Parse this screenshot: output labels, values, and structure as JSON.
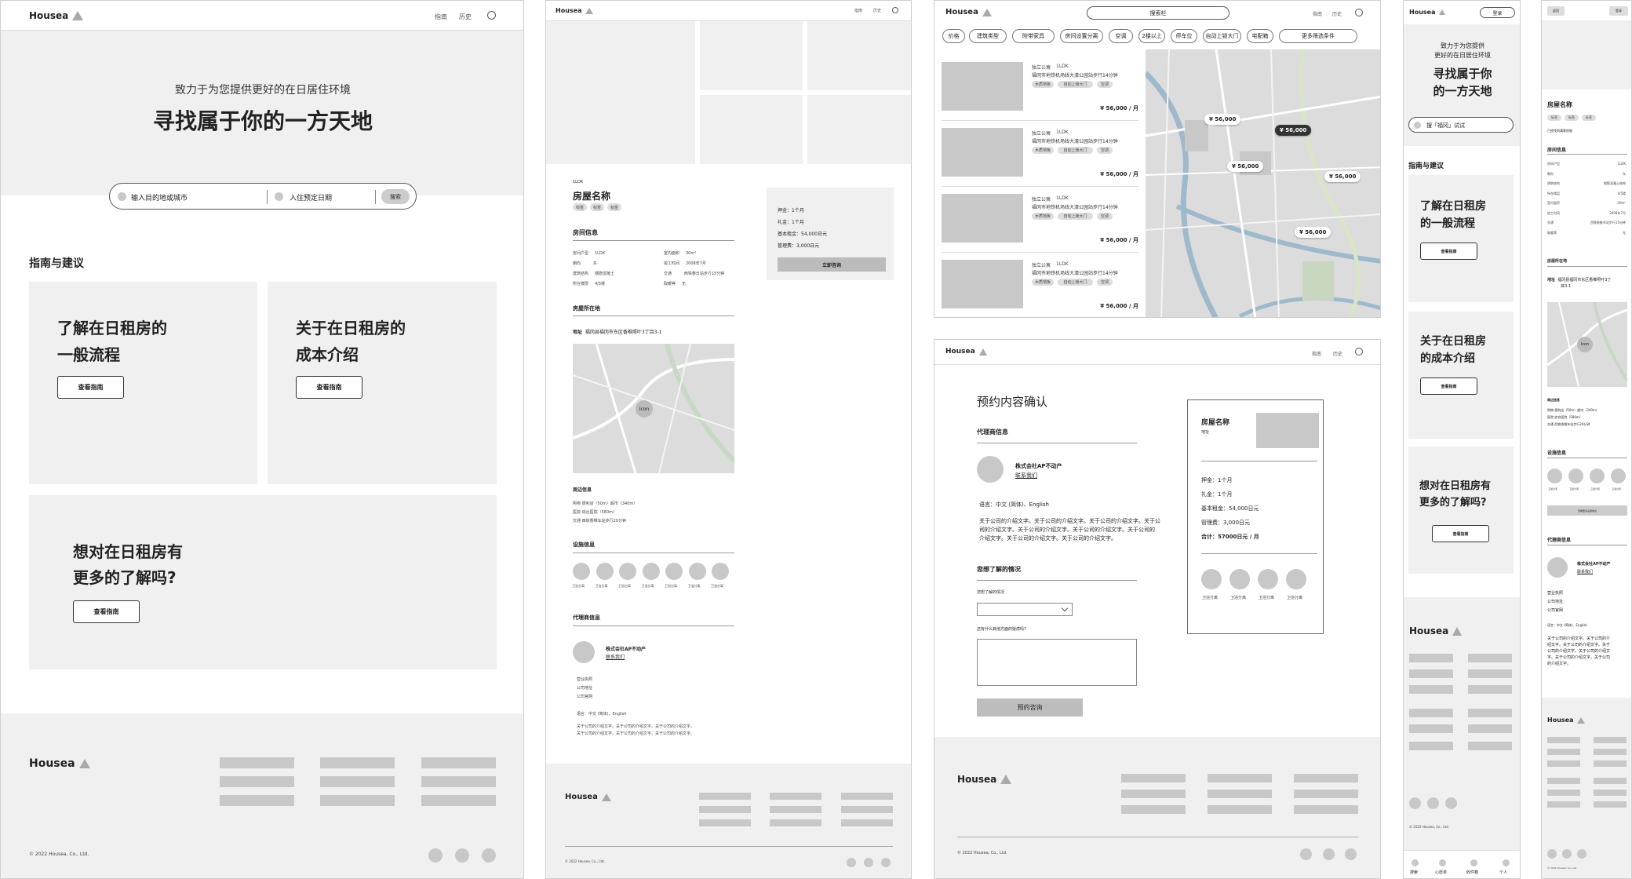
{
  "brand": "Housea",
  "nav": {
    "guide": "指南",
    "history": "历史"
  },
  "home": {
    "subtitle": "致力于为您提供更好的在日居住环境",
    "title": "寻找属于你的一方天地",
    "dest_placeholder": "输入目的地或城市",
    "date_placeholder": "入住预定日期",
    "search": "搜索",
    "section": "指南与建议",
    "card1": [
      "了解在日租房的",
      "一般流程"
    ],
    "card2": [
      "关于在日租房的",
      "成本介绍"
    ],
    "card3": [
      "想对在日租房有",
      "更多的了解吗?"
    ],
    "view_guide": "查看指南",
    "copyright": "© 2022 Housea, Co., Ltd."
  },
  "detail": {
    "type": "1LDK",
    "name": "房屋名称",
    "tags": [
      "标签",
      "标签",
      "标签"
    ],
    "sec_room": "房间信息",
    "room_left": [
      [
        "房间户型",
        "1LDK"
      ],
      [
        "朝向",
        "东"
      ],
      [
        "建筑结构",
        "钢筋混凝土"
      ],
      [
        "所在楼层",
        "4/5楼"
      ]
    ],
    "room_right": [
      [
        "室内面积",
        "30m²"
      ],
      [
        "竣工时间",
        "2008年7月"
      ],
      [
        "交通",
        "西铁春日站步行15分钟"
      ],
      [
        "取暖等",
        "无"
      ]
    ],
    "sec_location": "房屋所在地",
    "addr_label": "地址",
    "address": "福冈县福冈市东区香椎照叶3丁目3-1",
    "map_icon": "Icon",
    "sec_around": "周边信息",
    "around": [
      "购物 便利店（50m）超市（340m）",
      "医院 综合医院（580m）",
      "交通 西铁香椎车站步行20分钟"
    ],
    "sec_facility": "设施信息",
    "facility_label": "卫浴分离",
    "sec_agent": "代理商信息",
    "agent_name": "株式会社AP不动产",
    "contact": "联系我们",
    "agent_info": [
      "营业执照",
      "公司地址",
      "公司官网"
    ],
    "lang": "语言：中文 (简体)、English",
    "intro": [
      "关于公司的介绍文字。关于公司的介绍文字。关于公司的介绍文字。",
      "关于公司的介绍文字。关于公司的介绍文字。关于公司的介绍文字。"
    ],
    "side": [
      "押金：1个月",
      "礼金：1个月",
      "基本租金：54,000日元",
      "管理费：3,000日元"
    ],
    "consult": "立即咨询"
  },
  "list": {
    "search_bar": "搜索栏",
    "filters": [
      "价格",
      "建筑类型",
      "附带家具",
      "房间设置分离",
      "空调",
      "2楼以上",
      "停车位",
      "自动上锁大门",
      "宅配箱",
      "更多筛选条件"
    ],
    "item_type": "独立公寓",
    "item_layout": "1LDK",
    "item_addr": "福冈市地铁机场线大濠公园站步行14分钟",
    "item_tags": [
      "木质地板",
      "自动上锁大门",
      "空调"
    ],
    "price": "¥ 56,000 / 月",
    "pins": [
      "¥ 56,000",
      "¥ 56,000",
      "¥ 56,000",
      "¥ 56,000",
      "¥ 56,000"
    ]
  },
  "confirm": {
    "title": "预约内容确认",
    "sec_agent": "代理商信息",
    "agent_name": "株式会社AP不动产",
    "contact": "联系我们",
    "lang": "语言：中文 (简体)、English",
    "intro": [
      "关于公司的介绍文字。关于公司的介绍文字。关于公司的介绍文字。关于公",
      "司的介绍文字。关于公司的介绍文字。关于公司的介绍文字。关于公司的",
      "介绍文字。关于公司的介绍文字。关于公司的介绍文字。"
    ],
    "sec_want": "您想了解的情况",
    "want_label": "您想了解的情况",
    "other_label": "还有什么其他方面的疑虑吗?",
    "submit": "预约咨询",
    "card_name": "房屋名称",
    "card_addr": "地址",
    "card_lines": [
      "押金：1个月",
      "礼金：1个月",
      "基本租金：54,000日元",
      "管理费：3,000日元"
    ],
    "card_total": "合计：57000日元 / 月",
    "facility_label": "卫浴分离",
    "copyright": "© 2022 Housea, Co., Ltd."
  },
  "mobile": {
    "login": "登录",
    "subtitle": [
      "致力于为您提供",
      "更好的在日居住环境"
    ],
    "title": [
      "寻找属于你",
      "的一方天地"
    ],
    "search_placeholder": "搜「福冈」试试",
    "section": "指南与建议",
    "card1": [
      "了解在日租房",
      "的一般流程"
    ],
    "card2": [
      "关于在日租房",
      "的成本介绍"
    ],
    "card3": [
      "想对在日租房有",
      "更多的了解吗?"
    ],
    "view_guide": "查看指南",
    "copyright": "© 2022 Housea, Co., Ltd.",
    "tabs": [
      "搜索",
      "心愿单",
      "收件箱",
      "个人"
    ]
  },
  "mdetail": {
    "back": "返回",
    "login": "登录",
    "name": "房屋名称",
    "tags": [
      "标签",
      "标签",
      "标签"
    ],
    "expiry": "已经找到满意房屋",
    "sec_room": "房间信息",
    "rows": [
      [
        "房间户型",
        "1LDK"
      ],
      [
        "朝向",
        "东"
      ],
      [
        "建筑结构",
        "钢筋混凝土结构"
      ],
      [
        "所在楼层",
        "4/5楼"
      ],
      [
        "室内面积",
        "30m²"
      ],
      [
        "竣工时间",
        "2008年7月"
      ],
      [
        "交通",
        "西铁香椎车站步行15分钟"
      ],
      [
        "取暖等",
        "无"
      ]
    ],
    "sec_location": "房屋所在地",
    "addr_label": "地址",
    "address": [
      "福冈县福冈市东区香椎照叶3丁",
      "目3-1"
    ],
    "map_icon": "Icon",
    "sec_around": "周边信息",
    "around": [
      "购物 便利店（50m）超市（340m）",
      "医院 综合医院（580m）",
      "交通 西铁香椎车站步行20分钟"
    ],
    "sec_facility": "设施信息",
    "facility_label": "卫浴分离",
    "more_facility": "查看更多设施信息",
    "sec_agent": "代理商信息",
    "agent_name": "株式会社AP不动产",
    "contact": "联系我们",
    "agent_info": [
      "营业执照",
      "公司地址",
      "公司官网"
    ],
    "lang": "语言：中文 (简体)、English",
    "intro": [
      "关于公司的介绍文字。关于公司的介",
      "绍文字。关于公司的介绍文字。关于",
      "公司的介绍文字。关于公司的介绍文",
      "字。关于公司的介绍文字。关于公司",
      "的介绍文字。"
    ],
    "copyright": "© 2022 Housea, Co., Ltd."
  }
}
